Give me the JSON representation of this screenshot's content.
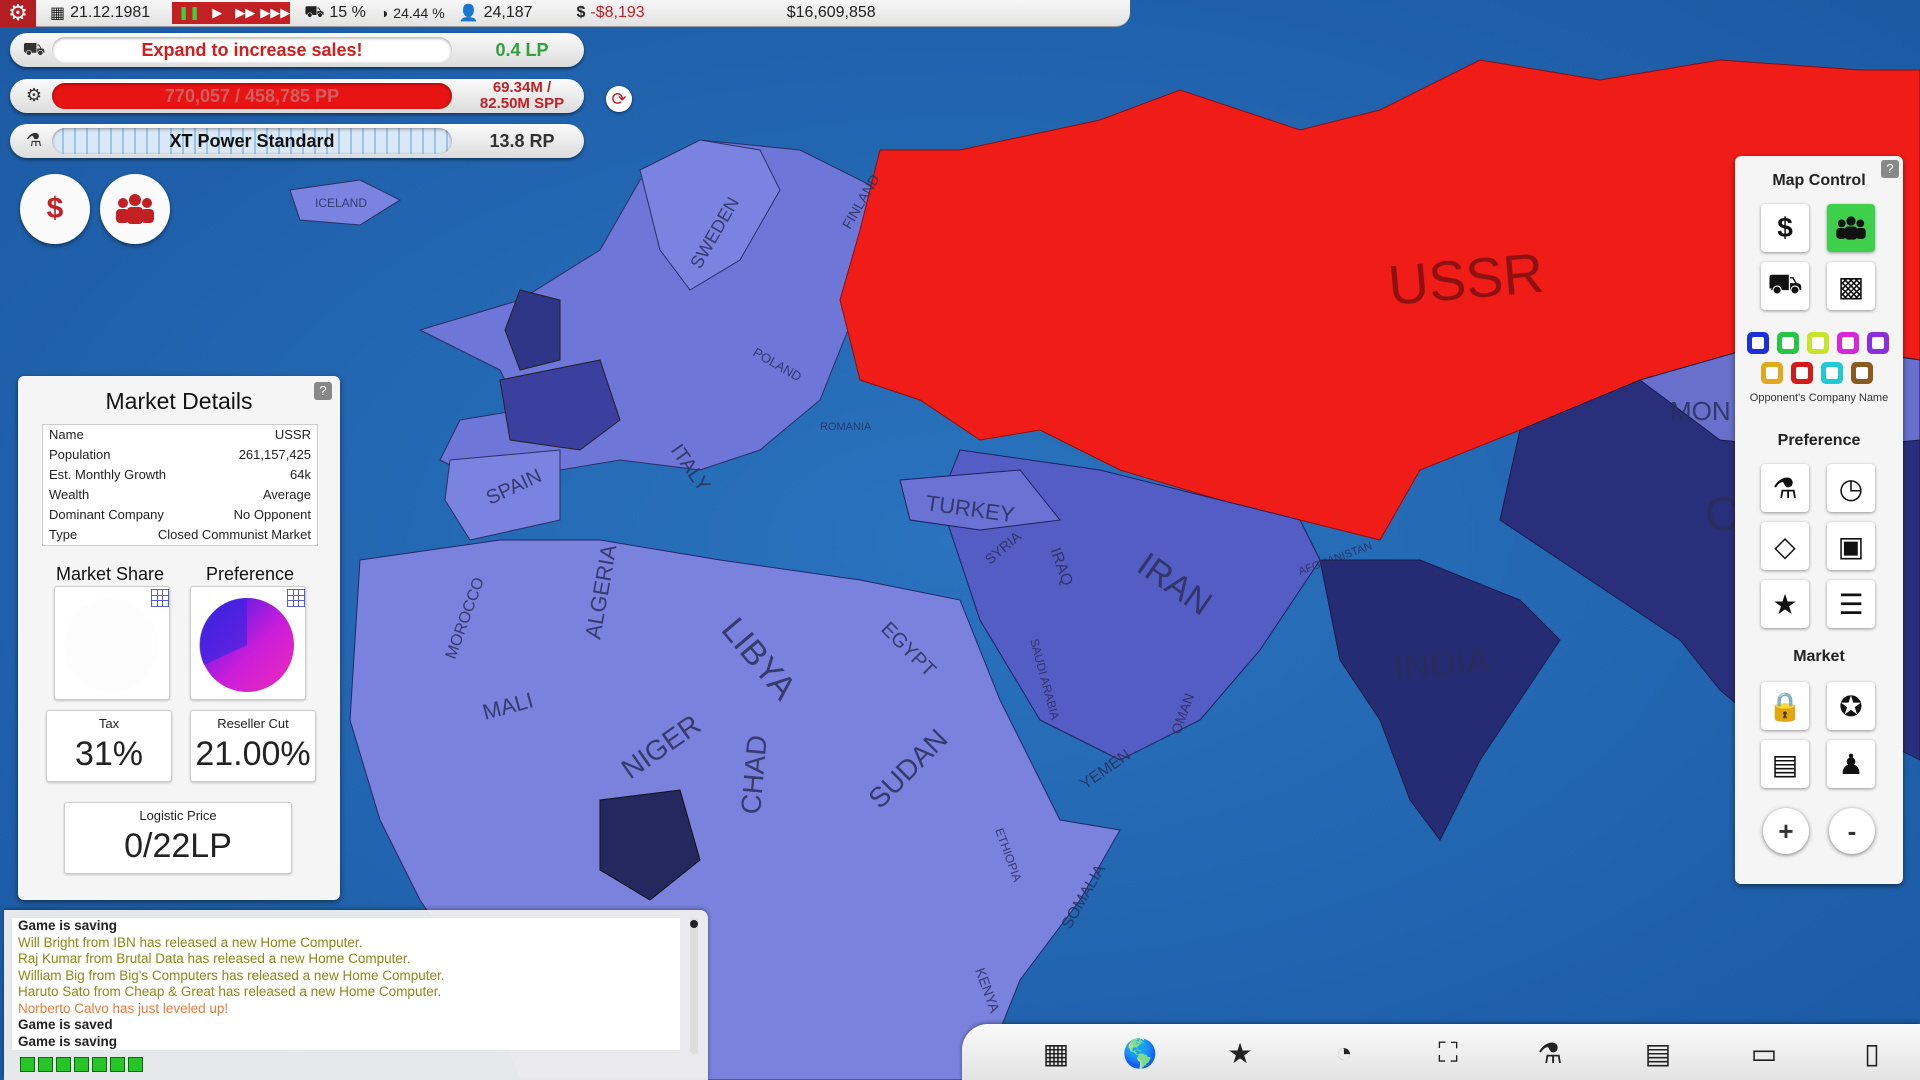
{
  "topbar": {
    "date": "21.12.1981",
    "market_share": "15 %",
    "global_share": "24.44 %",
    "employees": "24,187",
    "profit": "-$8,193",
    "cash": "$16,609,858"
  },
  "status": {
    "sales_message": "Expand to increase sales!",
    "sales_lp": "0.4 LP",
    "production_bar": "770,057 / 458,785 PP",
    "production_spp_1": "69.34M /",
    "production_spp_2": "82.50M SPP",
    "research_name": "XT Power Standard",
    "research_rp": "13.8 RP"
  },
  "market": {
    "title": "Market Details",
    "rows": [
      {
        "label": "Name",
        "value": "USSR"
      },
      {
        "label": "Population",
        "value": "261,157,425"
      },
      {
        "label": "Est. Monthly Growth",
        "value": "64k"
      },
      {
        "label": "Wealth",
        "value": "Average"
      },
      {
        "label": "Dominant Company",
        "value": "No Opponent"
      },
      {
        "label": "Type",
        "value": "Closed Communist Market"
      }
    ],
    "market_share_label": "Market Share",
    "preference_label": "Preference",
    "tax_label": "Tax",
    "tax_value": "31%",
    "reseller_label": "Reseller Cut",
    "reseller_value": "21.00%",
    "logistic_label": "Logistic Price",
    "logistic_value": "0/22LP"
  },
  "map_control": {
    "title": "Map Control",
    "opponent_label": "Opponent's Company Name",
    "preference_title": "Preference",
    "market_title": "Market",
    "zoom_in": "+",
    "zoom_out": "-",
    "swatches": [
      "#1c2fd8",
      "#25c545",
      "#c7e42a",
      "#d826d8",
      "#8a2ee0",
      "#e0a91e",
      "#d11b1b",
      "#20c9d4",
      "#8a5a20"
    ]
  },
  "map_labels": {
    "ussr": "USSR",
    "mon": "MON",
    "ch": "CH",
    "india": "INDIA",
    "iran": "IRAN",
    "turkey": "TURKEY",
    "libya": "LIBYA",
    "algeria": "ALGERIA",
    "egypt": "EGYPT",
    "sudan": "SUDAN",
    "niger": "NIGER",
    "chad": "CHAD",
    "mali": "MALI",
    "spain": "SPAIN",
    "sweden": "SWEDEN",
    "finland": "FINLAND",
    "poland": "POLAND",
    "iraq": "IRAQ",
    "syria": "SYRIA",
    "yemen": "YEMEN",
    "somalia": "SOMALIA",
    "kenya": "KENYA",
    "ethiopia": "ETHIOPIA",
    "oman": "OMAN",
    "iceland": "ICELAND",
    "morocco": "MOROCCO",
    "saudi": "SAUDI ARABIA",
    "afghanistan": "AFGHANISTAN",
    "romania": "ROMANIA",
    "italy": "ITALY"
  },
  "news": [
    {
      "text": "Game is saving",
      "kind": "dark"
    },
    {
      "text": "Will Bright from IBN has released a new Home Computer.",
      "kind": "olive"
    },
    {
      "text": "Raj Kumar from Brutal Data has released a new Home Computer.",
      "kind": "olive"
    },
    {
      "text": "William Big from Big's Computers has released a new Home Computer.",
      "kind": "olive"
    },
    {
      "text": "Haruto Sato from Cheap & Great has released a new Home Computer.",
      "kind": "olive"
    },
    {
      "text": "Norberto Calvo has just leveled up!",
      "kind": "orange"
    },
    {
      "text": "Game is saved",
      "kind": "dark"
    },
    {
      "text": "Game is saving",
      "kind": "dark"
    }
  ],
  "icons": {
    "topbar": [
      "gear-icon",
      "calendar-icon",
      "pause-icon",
      "play-icon",
      "fast-forward-icon",
      "fastest-icon",
      "truck-icon",
      "pie-icon",
      "person-icon",
      "dollar-icon"
    ],
    "bottombar": [
      "box-icon",
      "world-icon",
      "star-icon",
      "pie-chart-icon",
      "crane-icon",
      "microscope-icon",
      "document-icon",
      "computer-icon",
      "server-icon"
    ]
  }
}
